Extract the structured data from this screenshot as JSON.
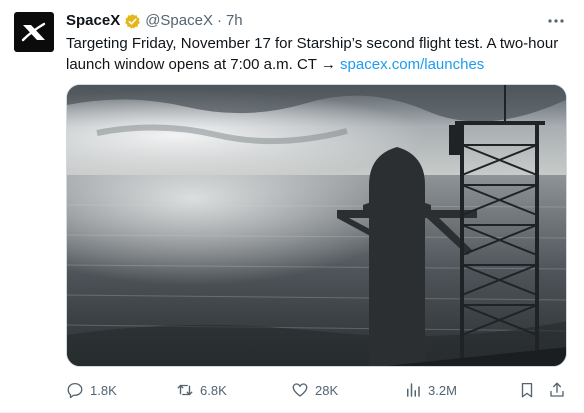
{
  "author": {
    "name": "SpaceX",
    "handle": "@SpaceX",
    "separator": "·",
    "time": "7h"
  },
  "tweet": {
    "text": "Targeting Friday, November 17 for Starship’s second flight test. A two-hour launch window opens at 7:00 a.m. CT → ",
    "link": "spacex.com/launches"
  },
  "actions": {
    "replies": "1.8K",
    "reposts": "6.8K",
    "likes": "28K",
    "views": "3.2M"
  },
  "colors": {
    "link": "#1d9bf0",
    "verified": "#e2b719",
    "muted": "#536471"
  },
  "icons": [
    "spacex-logo-icon",
    "verified-badge-icon",
    "more-icon",
    "reply-icon",
    "repost-icon",
    "like-icon",
    "views-icon",
    "bookmark-icon",
    "share-icon"
  ]
}
